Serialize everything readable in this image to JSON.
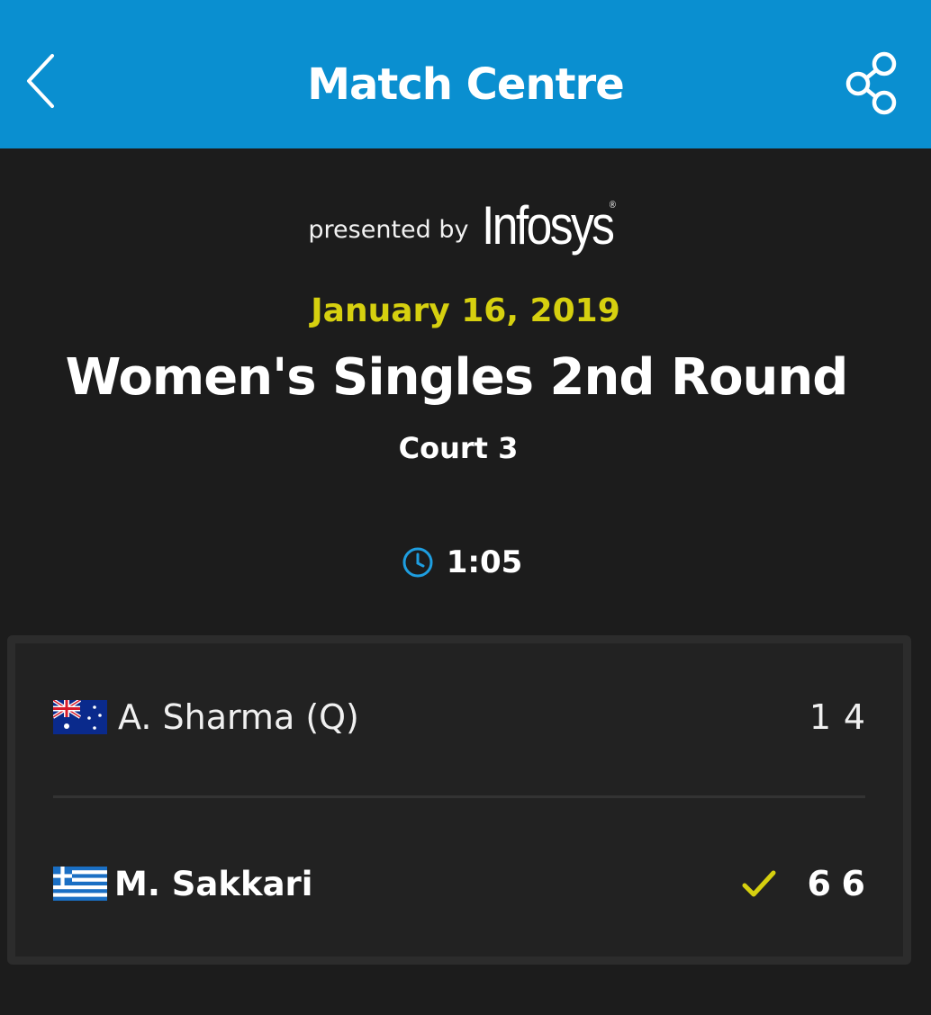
{
  "header": {
    "title": "Match Centre",
    "background_color": "#0a8fd0",
    "back_icon": "chevron-left-icon",
    "share_icon": "share-icon"
  },
  "sponsor": {
    "prefix": "presented by",
    "brand": "Infosys",
    "registered_mark": "®"
  },
  "match": {
    "date": "January 16, 2019",
    "round": "Women's Singles 2nd Round",
    "court": "Court 3",
    "duration": "1:05",
    "date_color": "#d6d00f"
  },
  "players": [
    {
      "name": "A. Sharma (Q)",
      "flag": "australia-flag",
      "winner": false,
      "sets": [
        "1",
        "4"
      ]
    },
    {
      "name": "M. Sakkari",
      "flag": "greece-flag",
      "winner": true,
      "sets": [
        "6",
        "6"
      ]
    }
  ],
  "winner_icon": "checkmark-icon",
  "accent_color": "#d6d00f"
}
